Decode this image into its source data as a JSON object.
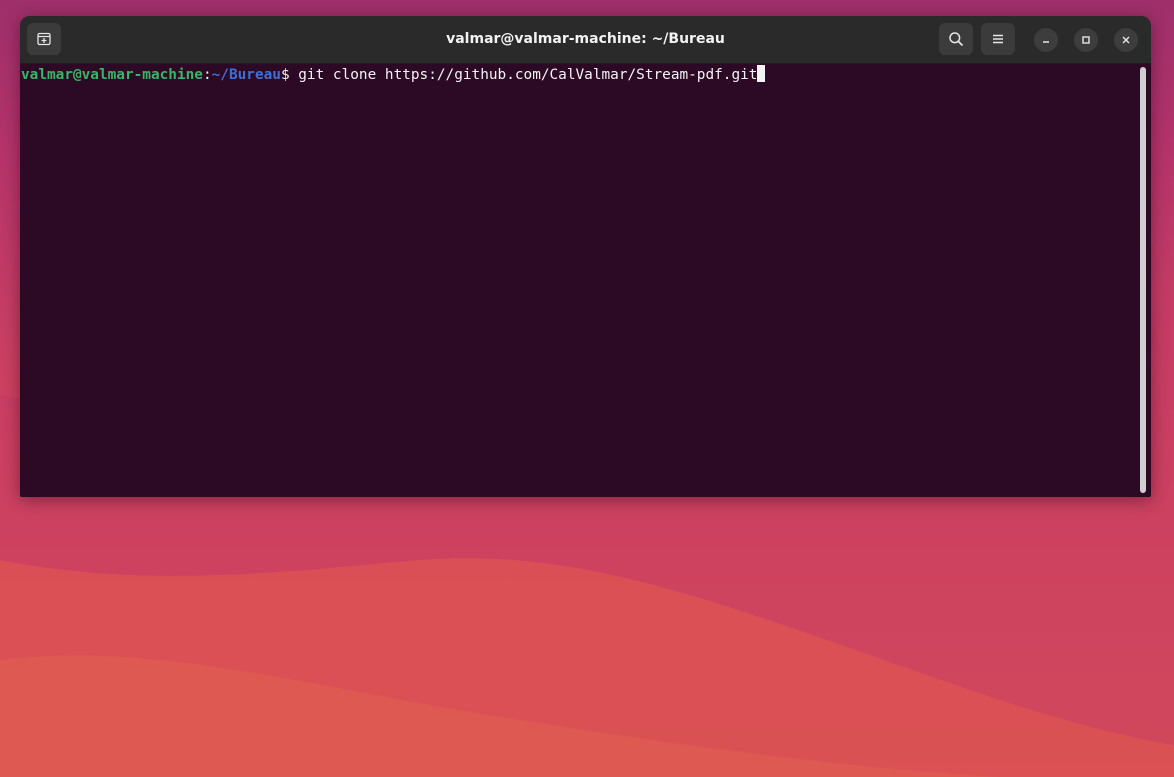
{
  "window": {
    "title": "valmar@valmar-machine: ~/Bureau"
  },
  "terminal": {
    "prompt_user_host": "valmar@valmar-machine",
    "prompt_colon": ":",
    "prompt_path": "~/Bureau",
    "prompt_symbol": "$ ",
    "command": "git clone https://github.com/CalValmar/Stream-pdf.git"
  },
  "icons": {
    "new_tab": "new-tab-icon",
    "search": "search-icon",
    "menu": "hamburger-menu-icon",
    "minimize": "minimize-icon",
    "maximize": "maximize-icon",
    "close": "close-icon"
  },
  "colors": {
    "terminal_bg": "#2c0a26",
    "titlebar_bg": "#2a2a2a",
    "prompt_user": "#39b566",
    "prompt_path": "#3f6fd1",
    "wallpaper_top": "#9d2f6b",
    "wallpaper_bottom": "#df5a4e"
  }
}
